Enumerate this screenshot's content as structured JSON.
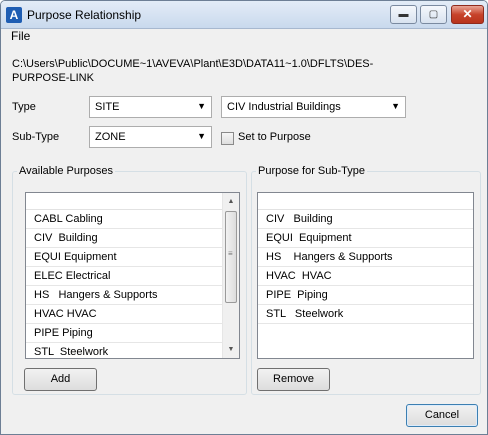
{
  "window": {
    "title": "Purpose Relationship",
    "app_icon": "A"
  },
  "title_buttons": {
    "minimize": "▬",
    "maximize": "▢",
    "close": "✕"
  },
  "menu": {
    "file": "File"
  },
  "path": "C:\\Users\\Public\\DOCUME~1\\AVEVA\\Plant\\E3D\\DATA11~1.0\\DFLTS\\DES-PURPOSE-LINK",
  "type": {
    "label": "Type",
    "value": "SITE",
    "purpose_value": "CIV  Industrial Buildings"
  },
  "subtype": {
    "label": "Sub-Type",
    "value": "ZONE",
    "set_to_purpose_label": "Set to Purpose",
    "set_to_purpose_checked": false
  },
  "available": {
    "title": "Available Purposes",
    "items": [
      "CABL Cabling",
      "CIV  Building",
      "EQUI Equipment",
      "ELEC Electrical",
      "HS   Hangers & Supports",
      "HVAC HVAC",
      "PIPE Piping",
      "STL  Steelwork"
    ],
    "add_label": "Add"
  },
  "subtype_purposes": {
    "title": "Purpose for Sub-Type",
    "items": [
      "CIV   Building",
      "EQUI  Equipment",
      "HS    Hangers & Supports",
      "HVAC  HVAC",
      "PIPE  Piping",
      "STL   Steelwork"
    ],
    "remove_label": "Remove"
  },
  "cancel_label": "Cancel"
}
